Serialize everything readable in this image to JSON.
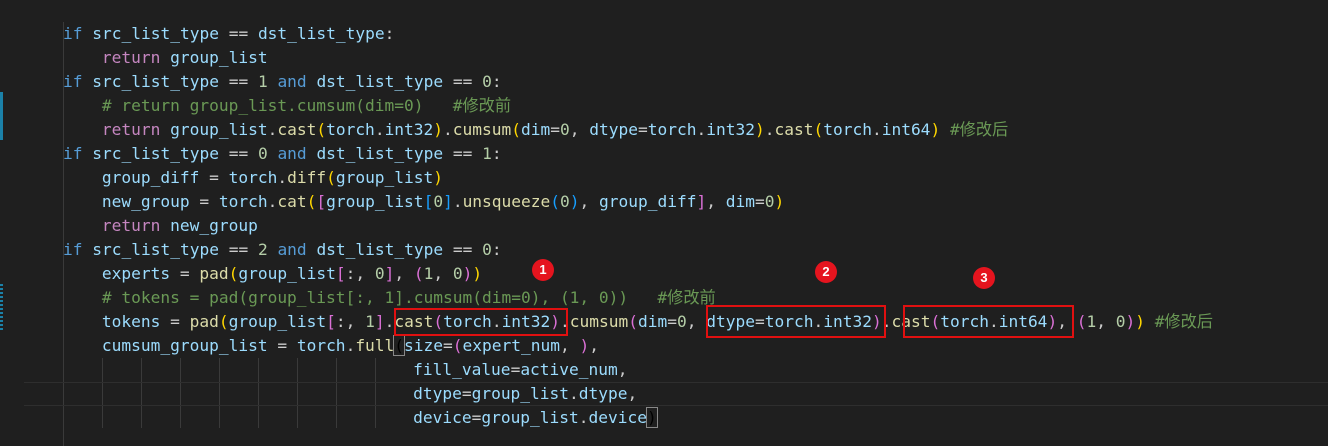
{
  "editor": {
    "lines": [
      {
        "indent": 0,
        "tokens": [
          [
            "k",
            "if"
          ],
          [
            "p",
            " "
          ],
          [
            "v",
            "src_list_type"
          ],
          [
            "p",
            " == "
          ],
          [
            "v",
            "dst_list_type"
          ],
          [
            "p",
            ":"
          ]
        ]
      },
      {
        "indent": 1,
        "tokens": [
          [
            "kw",
            "return"
          ],
          [
            "p",
            " "
          ],
          [
            "v",
            "group_list"
          ]
        ]
      },
      {
        "indent": 0,
        "tokens": [
          [
            "k",
            "if"
          ],
          [
            "p",
            " "
          ],
          [
            "v",
            "src_list_type"
          ],
          [
            "p",
            " == "
          ],
          [
            "n",
            "1"
          ],
          [
            "p",
            " "
          ],
          [
            "k",
            "and"
          ],
          [
            "p",
            " "
          ],
          [
            "v",
            "dst_list_type"
          ],
          [
            "p",
            " == "
          ],
          [
            "n",
            "0"
          ],
          [
            "p",
            ":"
          ]
        ]
      },
      {
        "indent": 1,
        "tokens": [
          [
            "c",
            "# return group_list.cumsum(dim=0)   #修改前"
          ]
        ]
      },
      {
        "indent": 1,
        "tokens": [
          [
            "kw",
            "return"
          ],
          [
            "p",
            " "
          ],
          [
            "v",
            "group_list"
          ],
          [
            "p",
            "."
          ],
          [
            "f",
            "cast"
          ],
          [
            "b1",
            "("
          ],
          [
            "v",
            "torch"
          ],
          [
            "p",
            "."
          ],
          [
            "v",
            "int32"
          ],
          [
            "b1",
            ")"
          ],
          [
            "p",
            "."
          ],
          [
            "f",
            "cumsum"
          ],
          [
            "b1",
            "("
          ],
          [
            "v",
            "dim"
          ],
          [
            "p",
            "="
          ],
          [
            "n",
            "0"
          ],
          [
            "p",
            ", "
          ],
          [
            "v",
            "dtype"
          ],
          [
            "p",
            "="
          ],
          [
            "v",
            "torch"
          ],
          [
            "p",
            "."
          ],
          [
            "v",
            "int32"
          ],
          [
            "b1",
            ")"
          ],
          [
            "p",
            "."
          ],
          [
            "f",
            "cast"
          ],
          [
            "b1",
            "("
          ],
          [
            "v",
            "torch"
          ],
          [
            "p",
            "."
          ],
          [
            "v",
            "int64"
          ],
          [
            "b1",
            ")"
          ],
          [
            "p",
            " "
          ],
          [
            "c",
            "#修改后"
          ]
        ]
      },
      {
        "indent": 0,
        "tokens": [
          [
            "k",
            "if"
          ],
          [
            "p",
            " "
          ],
          [
            "v",
            "src_list_type"
          ],
          [
            "p",
            " == "
          ],
          [
            "n",
            "0"
          ],
          [
            "p",
            " "
          ],
          [
            "k",
            "and"
          ],
          [
            "p",
            " "
          ],
          [
            "v",
            "dst_list_type"
          ],
          [
            "p",
            " == "
          ],
          [
            "n",
            "1"
          ],
          [
            "p",
            ":"
          ]
        ]
      },
      {
        "indent": 1,
        "tokens": [
          [
            "v",
            "group_diff"
          ],
          [
            "p",
            " = "
          ],
          [
            "v",
            "torch"
          ],
          [
            "p",
            "."
          ],
          [
            "f",
            "diff"
          ],
          [
            "b1",
            "("
          ],
          [
            "v",
            "group_list"
          ],
          [
            "b1",
            ")"
          ]
        ]
      },
      {
        "indent": 1,
        "tokens": [
          [
            "v",
            "new_group"
          ],
          [
            "p",
            " = "
          ],
          [
            "v",
            "torch"
          ],
          [
            "p",
            "."
          ],
          [
            "f",
            "cat"
          ],
          [
            "b1",
            "("
          ],
          [
            "b2",
            "["
          ],
          [
            "v",
            "group_list"
          ],
          [
            "b3",
            "["
          ],
          [
            "n",
            "0"
          ],
          [
            "b3",
            "]"
          ],
          [
            "p",
            "."
          ],
          [
            "f",
            "unsqueeze"
          ],
          [
            "b3",
            "("
          ],
          [
            "n",
            "0"
          ],
          [
            "b3",
            ")"
          ],
          [
            "p",
            ", "
          ],
          [
            "v",
            "group_diff"
          ],
          [
            "b2",
            "]"
          ],
          [
            "p",
            ", "
          ],
          [
            "v",
            "dim"
          ],
          [
            "p",
            "="
          ],
          [
            "n",
            "0"
          ],
          [
            "b1",
            ")"
          ]
        ]
      },
      {
        "indent": 1,
        "tokens": [
          [
            "kw",
            "return"
          ],
          [
            "p",
            " "
          ],
          [
            "v",
            "new_group"
          ]
        ]
      },
      {
        "indent": 0,
        "tokens": [
          [
            "k",
            "if"
          ],
          [
            "p",
            " "
          ],
          [
            "v",
            "src_list_type"
          ],
          [
            "p",
            " == "
          ],
          [
            "n",
            "2"
          ],
          [
            "p",
            " "
          ],
          [
            "k",
            "and"
          ],
          [
            "p",
            " "
          ],
          [
            "v",
            "dst_list_type"
          ],
          [
            "p",
            " == "
          ],
          [
            "n",
            "0"
          ],
          [
            "p",
            ":"
          ]
        ]
      },
      {
        "indent": 1,
        "tokens": [
          [
            "v",
            "experts"
          ],
          [
            "p",
            " = "
          ],
          [
            "f",
            "pad"
          ],
          [
            "b1",
            "("
          ],
          [
            "v",
            "group_list"
          ],
          [
            "b2",
            "["
          ],
          [
            "p",
            ":, "
          ],
          [
            "n",
            "0"
          ],
          [
            "b2",
            "]"
          ],
          [
            "p",
            ", "
          ],
          [
            "b2",
            "("
          ],
          [
            "n",
            "1"
          ],
          [
            "p",
            ", "
          ],
          [
            "n",
            "0"
          ],
          [
            "b2",
            ")"
          ],
          [
            "b1",
            ")"
          ]
        ]
      },
      {
        "indent": 1,
        "tokens": [
          [
            "c",
            "# tokens = pad(group_list[:, 1].cumsum(dim=0), (1, 0))   #修改前"
          ]
        ]
      },
      {
        "indent": 1,
        "tokens": [
          [
            "v",
            "tokens"
          ],
          [
            "p",
            " = "
          ],
          [
            "f",
            "pad"
          ],
          [
            "b1",
            "("
          ],
          [
            "v",
            "group_list"
          ],
          [
            "b2",
            "["
          ],
          [
            "p",
            ":, "
          ],
          [
            "n",
            "1"
          ],
          [
            "b2",
            "]"
          ],
          [
            "p",
            "."
          ],
          [
            "f",
            "cast"
          ],
          [
            "b2",
            "("
          ],
          [
            "v",
            "torch"
          ],
          [
            "p",
            "."
          ],
          [
            "v",
            "int32"
          ],
          [
            "b2",
            ")"
          ],
          [
            "p",
            "."
          ],
          [
            "f",
            "cumsum"
          ],
          [
            "b2",
            "("
          ],
          [
            "v",
            "dim"
          ],
          [
            "p",
            "="
          ],
          [
            "n",
            "0"
          ],
          [
            "p",
            ", "
          ],
          [
            "v",
            "dtype"
          ],
          [
            "p",
            "="
          ],
          [
            "v",
            "torch"
          ],
          [
            "p",
            "."
          ],
          [
            "v",
            "int32"
          ],
          [
            "b2",
            ")"
          ],
          [
            "p",
            "."
          ],
          [
            "f",
            "cast"
          ],
          [
            "b2",
            "("
          ],
          [
            "v",
            "torch"
          ],
          [
            "p",
            "."
          ],
          [
            "v",
            "int64"
          ],
          [
            "b2",
            ")"
          ],
          [
            "p",
            ", "
          ],
          [
            "b2",
            "("
          ],
          [
            "n",
            "1"
          ],
          [
            "p",
            ", "
          ],
          [
            "n",
            "0"
          ],
          [
            "b2",
            ")"
          ],
          [
            "b1",
            ")"
          ],
          [
            "p",
            " "
          ],
          [
            "c",
            "#修改后"
          ]
        ]
      },
      {
        "indent": 1,
        "tokens": [
          [
            "v",
            "cumsum_group_list"
          ],
          [
            "p",
            " = "
          ],
          [
            "v",
            "torch"
          ],
          [
            "p",
            "."
          ],
          [
            "f",
            "full"
          ],
          [
            "bm",
            "("
          ],
          [
            "v",
            "size"
          ],
          [
            "p",
            "="
          ],
          [
            "b2",
            "("
          ],
          [
            "v",
            "expert_num"
          ],
          [
            "p",
            ", "
          ],
          [
            "b2",
            ")"
          ],
          [
            "p",
            ","
          ]
        ]
      },
      {
        "indent": 9,
        "tokens": [
          [
            "v",
            "fill_value"
          ],
          [
            "p",
            "="
          ],
          [
            "v",
            "active_num"
          ],
          [
            "p",
            ","
          ]
        ]
      },
      {
        "indent": 9,
        "tokens": [
          [
            "v",
            "dtype"
          ],
          [
            "p",
            "="
          ],
          [
            "v",
            "group_list"
          ],
          [
            "p",
            "."
          ],
          [
            "v",
            "dtype"
          ],
          [
            "p",
            ","
          ]
        ]
      },
      {
        "indent": 9,
        "tokens": [
          [
            "v",
            "device"
          ],
          [
            "p",
            "="
          ],
          [
            "v",
            "group_list"
          ],
          [
            "p",
            "."
          ],
          [
            "v",
            "device"
          ],
          [
            "bm",
            ")"
          ]
        ]
      }
    ]
  },
  "annotations": [
    {
      "label": "1"
    },
    {
      "label": "2"
    },
    {
      "label": "3"
    }
  ],
  "colors": {
    "background": "#1f1f1f",
    "keyword": "#569cd6",
    "control": "#c586c0",
    "variable": "#9cdcfe",
    "function": "#dcdcaa",
    "number": "#b5cea8",
    "comment": "#6a9955",
    "annotation_red": "#e01010"
  }
}
